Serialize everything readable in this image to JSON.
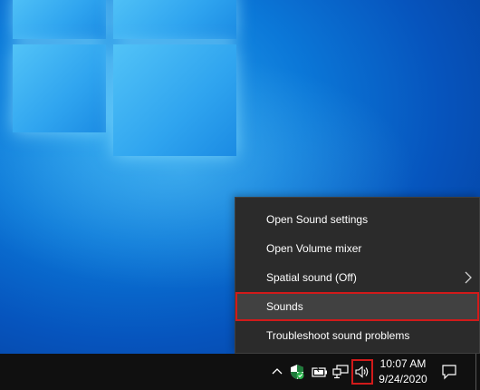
{
  "context_menu": {
    "items": [
      {
        "label": "Open Sound settings",
        "has_submenu": false
      },
      {
        "label": "Open Volume mixer",
        "has_submenu": false
      },
      {
        "label": "Spatial sound (Off)",
        "has_submenu": true
      },
      {
        "label": "Sounds",
        "has_submenu": false,
        "highlighted": true
      },
      {
        "label": "Troubleshoot sound problems",
        "has_submenu": false
      }
    ]
  },
  "taskbar": {
    "clock": {
      "time": "10:07 AM",
      "date": "9/24/2020"
    },
    "tray_icons": [
      "chevron-up-icon",
      "security-shield-icon",
      "battery-icon",
      "network-icon",
      "volume-icon"
    ],
    "notification_icon": "action-center-icon"
  },
  "colors": {
    "menu_background": "#2b2b2b",
    "menu_highlight": "#414141",
    "annotation_red": "#d11a1a",
    "taskbar": "#101010",
    "desktop_blue": "#0b78d8"
  }
}
